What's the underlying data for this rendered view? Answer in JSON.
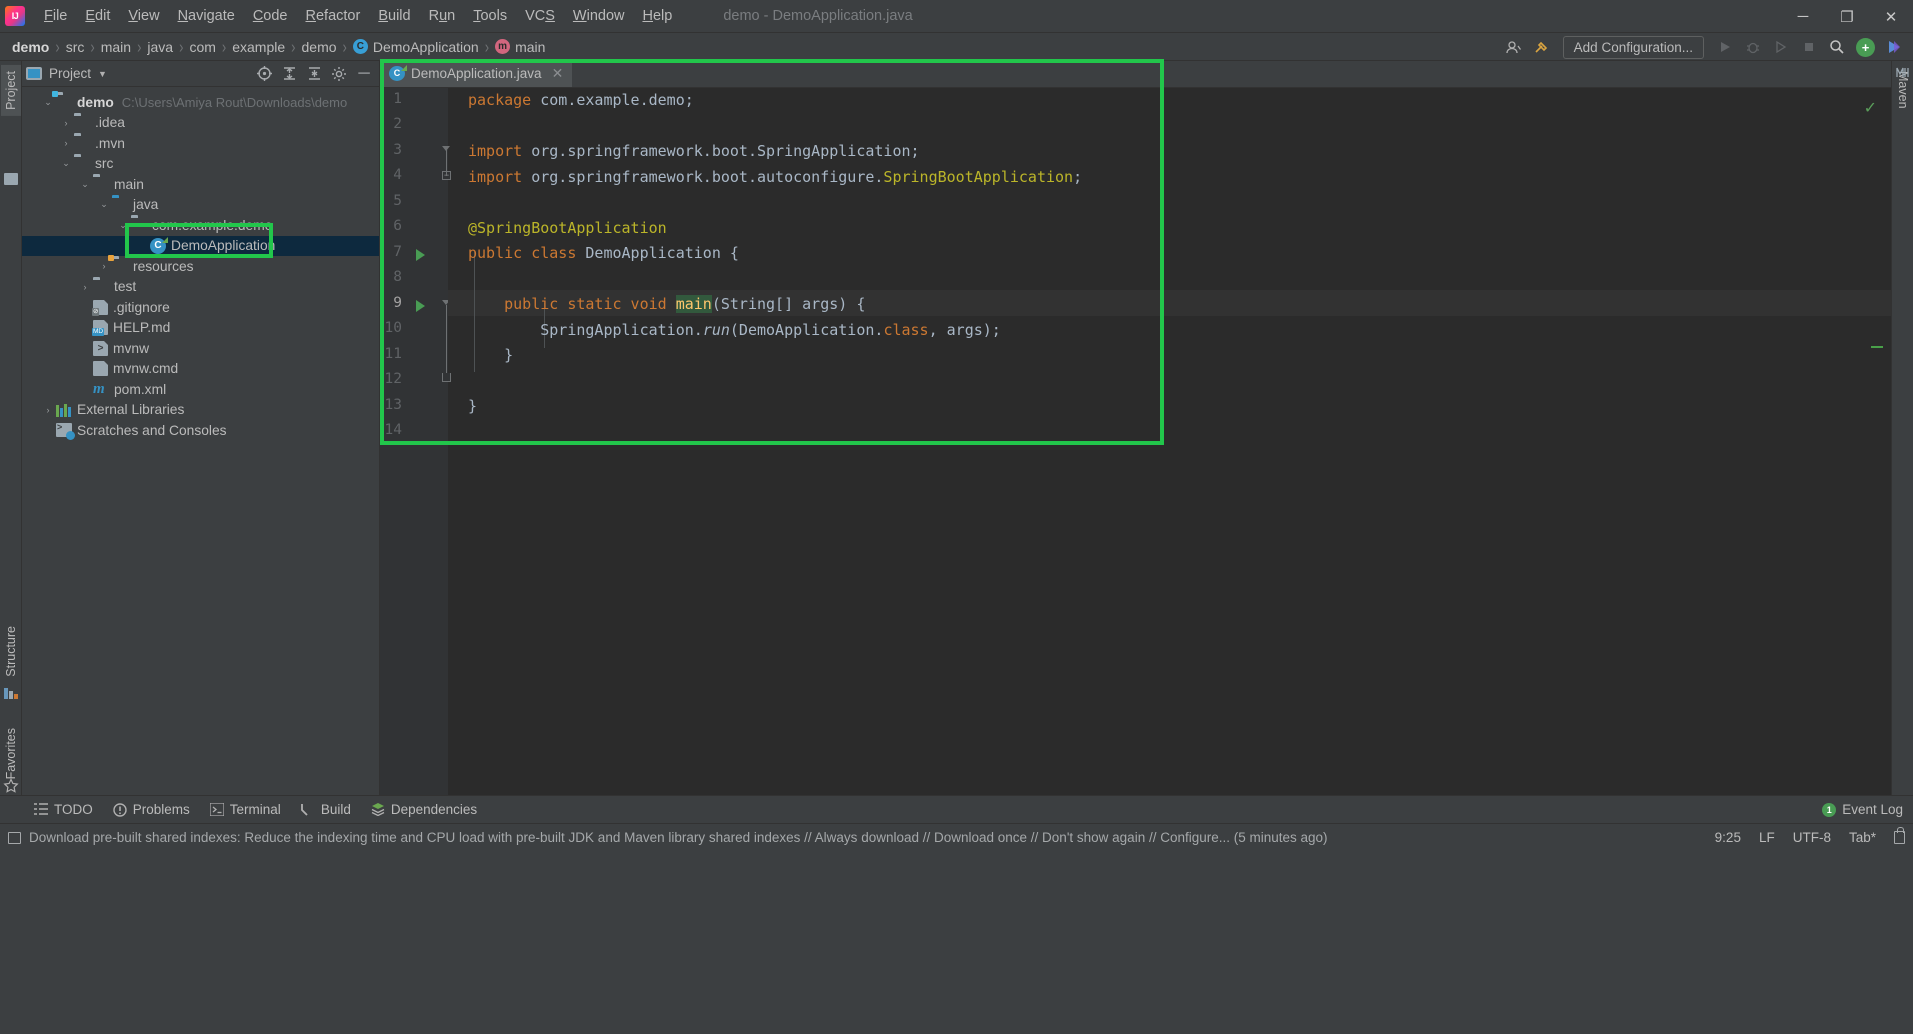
{
  "window": {
    "title": "demo - DemoApplication.java",
    "minimize_label": "─",
    "maximize_label": "❐",
    "close_label": "✕"
  },
  "menu": {
    "items": [
      {
        "label": "File",
        "mnemonic": "F"
      },
      {
        "label": "Edit",
        "mnemonic": "E"
      },
      {
        "label": "View",
        "mnemonic": "V"
      },
      {
        "label": "Navigate",
        "mnemonic": "N"
      },
      {
        "label": "Code",
        "mnemonic": "C"
      },
      {
        "label": "Refactor",
        "mnemonic": "R"
      },
      {
        "label": "Build",
        "mnemonic": "B"
      },
      {
        "label": "Run",
        "mnemonic": "u"
      },
      {
        "label": "Tools",
        "mnemonic": "T"
      },
      {
        "label": "VCS",
        "mnemonic": "S"
      },
      {
        "label": "Window",
        "mnemonic": "W"
      },
      {
        "label": "Help",
        "mnemonic": "H"
      }
    ]
  },
  "breadcrumb": {
    "items": [
      {
        "label": "demo",
        "bold": true,
        "icon": ""
      },
      {
        "label": "src",
        "bold": false,
        "icon": ""
      },
      {
        "label": "main",
        "bold": false,
        "icon": ""
      },
      {
        "label": "java",
        "bold": false,
        "icon": ""
      },
      {
        "label": "com",
        "bold": false,
        "icon": ""
      },
      {
        "label": "example",
        "bold": false,
        "icon": ""
      },
      {
        "label": "demo",
        "bold": false,
        "icon": ""
      },
      {
        "label": "DemoApplication",
        "bold": false,
        "icon": "class-badge"
      },
      {
        "label": "main",
        "bold": false,
        "icon": "method-badge"
      }
    ],
    "separator": "›"
  },
  "toolbar": {
    "add_configuration_label": "Add Configuration...",
    "run_label": "▶",
    "debug_label": "🐞",
    "run_coverage_label": "⏵",
    "stop_label": "■",
    "search_label": "🔍",
    "user_label": "👤",
    "build_label": "🔨",
    "updates_label": "+",
    "ide_assistant_label": "▶"
  },
  "left_strip": {
    "project_tab": "Project",
    "structure_tab": "Structure",
    "favorites_tab": "Favorites"
  },
  "right_strip": {
    "maven_tab": "Maven"
  },
  "project_panel": {
    "title": "Project",
    "dropdown_caret": "▼",
    "tool_locate": "⊕",
    "tool_expand": "≣",
    "tool_collapse": "≡",
    "tool_settings": "⚙",
    "tool_hide": "─",
    "tree": [
      {
        "label": "demo",
        "path": "C:\\Users\\Amiya Rout\\Downloads\\demo",
        "indent": 0,
        "chev": "⌄",
        "icon": "folder-module",
        "bold": true,
        "selected": false
      },
      {
        "label": ".idea",
        "path": "",
        "indent": 1,
        "chev": "›",
        "icon": "folder",
        "bold": false,
        "selected": false
      },
      {
        "label": ".mvn",
        "path": "",
        "indent": 1,
        "chev": "›",
        "icon": "folder",
        "bold": false,
        "selected": false
      },
      {
        "label": "src",
        "path": "",
        "indent": 1,
        "chev": "⌄",
        "icon": "folder",
        "bold": false,
        "selected": false
      },
      {
        "label": "main",
        "path": "",
        "indent": 2,
        "chev": "⌄",
        "icon": "folder",
        "bold": false,
        "selected": false
      },
      {
        "label": "java",
        "path": "",
        "indent": 3,
        "chev": "⌄",
        "icon": "folder-source",
        "bold": false,
        "selected": false
      },
      {
        "label": "com.example.demo",
        "path": "",
        "indent": 4,
        "chev": "⌄",
        "icon": "folder-package",
        "bold": false,
        "selected": false
      },
      {
        "label": "DemoApplication",
        "path": "",
        "indent": 5,
        "chev": "",
        "icon": "spring-class",
        "bold": false,
        "selected": true
      },
      {
        "label": "resources",
        "path": "",
        "indent": 3,
        "chev": "›",
        "icon": "folder-resources",
        "bold": false,
        "selected": false
      },
      {
        "label": "test",
        "path": "",
        "indent": 2,
        "chev": "›",
        "icon": "folder",
        "bold": false,
        "selected": false
      },
      {
        "label": ".gitignore",
        "path": "",
        "indent": 2,
        "chev": "",
        "icon": "file-gitignore",
        "bold": false,
        "selected": false
      },
      {
        "label": "HELP.md",
        "path": "",
        "indent": 2,
        "chev": "",
        "icon": "file-md",
        "bold": false,
        "selected": false
      },
      {
        "label": "mvnw",
        "path": "",
        "indent": 2,
        "chev": "",
        "icon": "file-script",
        "bold": false,
        "selected": false
      },
      {
        "label": "mvnw.cmd",
        "path": "",
        "indent": 2,
        "chev": "",
        "icon": "file-cmd",
        "bold": false,
        "selected": false
      },
      {
        "label": "pom.xml",
        "path": "",
        "indent": 2,
        "chev": "",
        "icon": "file-maven",
        "bold": false,
        "selected": false
      },
      {
        "label": "External Libraries",
        "path": "",
        "indent": 0,
        "chev": "›",
        "icon": "libraries",
        "bold": false,
        "selected": false
      },
      {
        "label": "Scratches and Consoles",
        "path": "",
        "indent": 0,
        "chev": "",
        "icon": "scratches",
        "bold": false,
        "selected": false
      }
    ]
  },
  "editor": {
    "tab_label": "DemoApplication.java",
    "tab_close": "✕",
    "inspection_ok": "✓",
    "lines": [
      {
        "num": 1,
        "text": "package com.example.demo;"
      },
      {
        "num": 2,
        "text": ""
      },
      {
        "num": 3,
        "text": "import org.springframework.boot.SpringApplication;"
      },
      {
        "num": 4,
        "text": "import org.springframework.boot.autoconfigure.SpringBootApplication;"
      },
      {
        "num": 5,
        "text": ""
      },
      {
        "num": 6,
        "text": "@SpringBootApplication"
      },
      {
        "num": 7,
        "text": "public class DemoApplication {"
      },
      {
        "num": 8,
        "text": ""
      },
      {
        "num": 9,
        "text": "    public static void main(String[] args) {"
      },
      {
        "num": 10,
        "text": "        SpringApplication.run(DemoApplication.class, args);"
      },
      {
        "num": 11,
        "text": "    }"
      },
      {
        "num": 12,
        "text": ""
      },
      {
        "num": 13,
        "text": "}"
      },
      {
        "num": 14,
        "text": ""
      }
    ]
  },
  "bottom_bar": {
    "buttons": [
      {
        "label": "TODO",
        "icon": "todo-icon"
      },
      {
        "label": "Problems",
        "icon": "problems-icon"
      },
      {
        "label": "Terminal",
        "icon": "terminal-icon"
      },
      {
        "label": "Build",
        "icon": "build-icon"
      },
      {
        "label": "Dependencies",
        "icon": "dependencies-icon"
      }
    ],
    "event_log_label": "Event Log",
    "event_log_count": "1"
  },
  "status_bar": {
    "message": "Download pre-built shared indexes: Reduce the indexing time and CPU load with pre-built JDK and Maven library shared indexes // Always download // Download once // Don't show again // Configure... (5 minutes ago)",
    "position": "9:25",
    "line_sep": "LF",
    "encoding": "UTF-8",
    "indent": "Tab*"
  },
  "colors": {
    "accent_green": "#22c64b",
    "keyword": "#cc7832",
    "annotation": "#bbb529",
    "text": "#a9b7c6",
    "selection": "#0d293e",
    "panel_bg": "#3c3f41",
    "editor_bg": "#2b2b2b",
    "gutter_bg": "#313335"
  }
}
